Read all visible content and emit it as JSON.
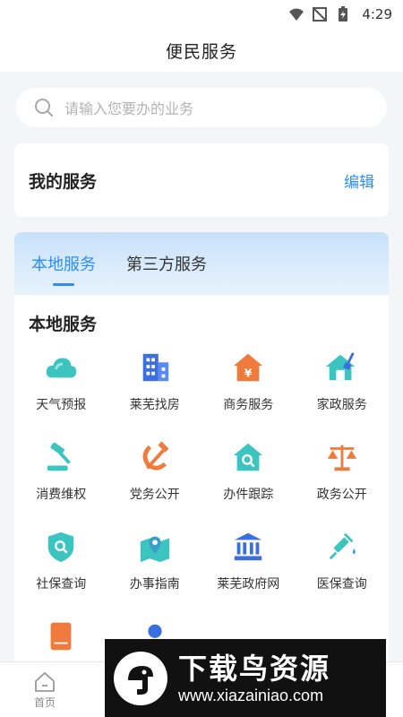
{
  "status_bar": {
    "time": "4:29",
    "wifi_icon": "wifi-icon",
    "signal_icon": "no-signal-icon",
    "battery_icon": "battery-charging-icon"
  },
  "header": {
    "title": "便民服务"
  },
  "search": {
    "placeholder": "请输入您要办的业务",
    "icon": "search-icon"
  },
  "my_services": {
    "title": "我的服务",
    "edit_label": "编辑"
  },
  "tabs": [
    {
      "label": "本地服务",
      "active": true
    },
    {
      "label": "第三方服务",
      "active": false
    }
  ],
  "local_services": {
    "title": "本地服务",
    "items": [
      {
        "label": "天气预报",
        "icon": "cloud-icon"
      },
      {
        "label": "莱芜找房",
        "icon": "building-icon"
      },
      {
        "label": "商务服务",
        "icon": "yen-house-icon"
      },
      {
        "label": "家政服务",
        "icon": "house-broom-icon"
      },
      {
        "label": "消费维权",
        "icon": "gavel-icon"
      },
      {
        "label": "党务公开",
        "icon": "hammer-sickle-icon"
      },
      {
        "label": "办件跟踪",
        "icon": "house-search-icon"
      },
      {
        "label": "政务公开",
        "icon": "scales-icon"
      },
      {
        "label": "社保查询",
        "icon": "shield-search-icon"
      },
      {
        "label": "办事指南",
        "icon": "map-pin-icon"
      },
      {
        "label": "莱芜政府网",
        "icon": "government-building-icon"
      },
      {
        "label": "医保查询",
        "icon": "syringe-icon"
      },
      {
        "label": "",
        "icon": "book-icon"
      },
      {
        "label": "",
        "icon": "dot-icon"
      }
    ]
  },
  "bottom_nav": {
    "home_label": "首页"
  },
  "watermark": {
    "main_text": "下载鸟资源",
    "url": "www.xiazainiao.com"
  },
  "colors": {
    "accent": "#2f8ff0",
    "teal": "#3cc5c0",
    "orange": "#f07a3c",
    "blue": "#3b6fe0"
  }
}
